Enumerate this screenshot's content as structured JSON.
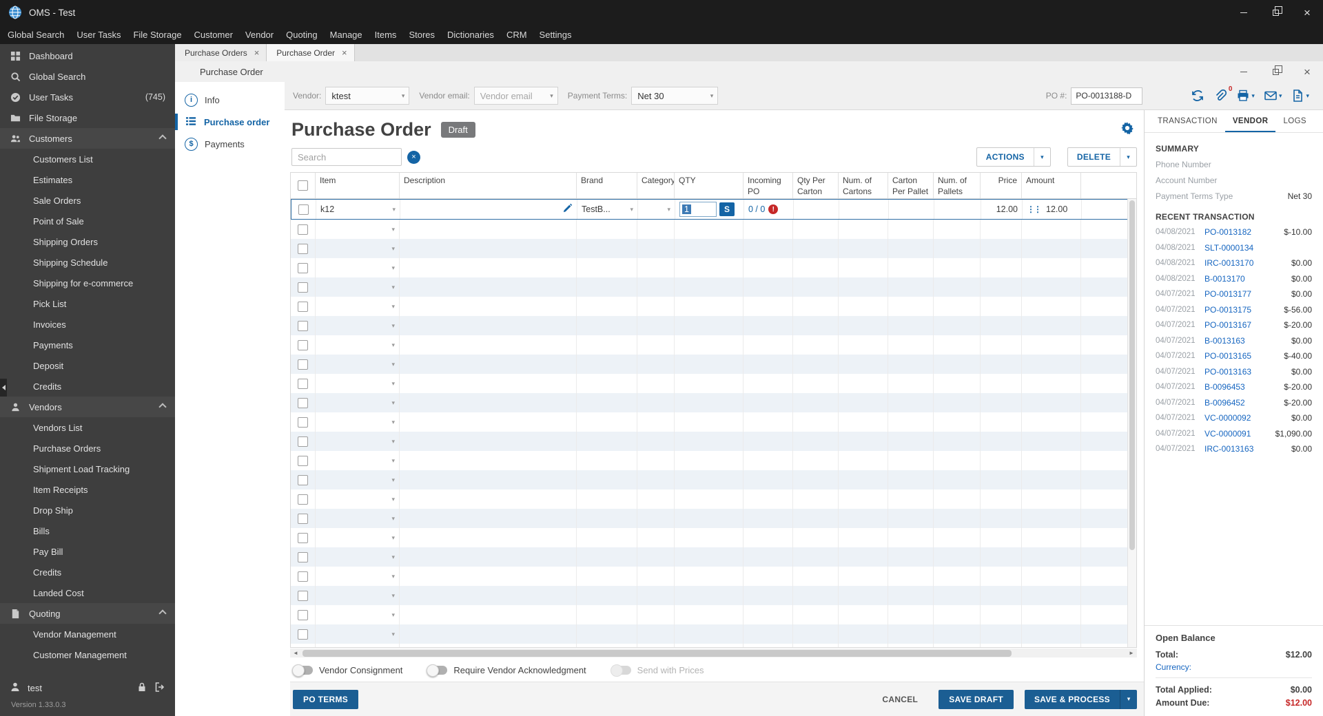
{
  "titlebar": {
    "title": "OMS - Test"
  },
  "menu": {
    "items": [
      {
        "label": "Global Search"
      },
      {
        "label": "User Tasks"
      },
      {
        "label": "File Storage"
      },
      {
        "label": "Customer"
      },
      {
        "label": "Vendor"
      },
      {
        "label": "Quoting"
      },
      {
        "label": "Manage"
      },
      {
        "label": "Items"
      },
      {
        "label": "Stores"
      },
      {
        "label": "Dictionaries"
      },
      {
        "label": "CRM"
      },
      {
        "label": "Settings"
      }
    ]
  },
  "sidebar": {
    "items": [
      {
        "label": "Dashboard",
        "icon": "dashboard",
        "type": "item"
      },
      {
        "label": "Global Search",
        "icon": "search",
        "type": "item"
      },
      {
        "label": "User Tasks",
        "icon": "tasks",
        "type": "item",
        "badge": "(745)"
      },
      {
        "label": "File Storage",
        "icon": "storage",
        "type": "item"
      },
      {
        "label": "Customers",
        "icon": "customers",
        "type": "group"
      },
      {
        "label": "Customers List",
        "type": "sub"
      },
      {
        "label": "Estimates",
        "type": "sub"
      },
      {
        "label": "Sale Orders",
        "type": "sub"
      },
      {
        "label": "Point of Sale",
        "type": "sub"
      },
      {
        "label": "Shipping Orders",
        "type": "sub"
      },
      {
        "label": "Shipping Schedule",
        "type": "sub"
      },
      {
        "label": "Shipping for e-commerce",
        "type": "sub"
      },
      {
        "label": "Pick List",
        "type": "sub"
      },
      {
        "label": "Invoices",
        "type": "sub"
      },
      {
        "label": "Payments",
        "type": "sub"
      },
      {
        "label": "Deposit",
        "type": "sub"
      },
      {
        "label": "Credits",
        "type": "sub"
      },
      {
        "label": "Vendors",
        "icon": "vendors",
        "type": "group"
      },
      {
        "label": "Vendors List",
        "type": "sub"
      },
      {
        "label": "Purchase Orders",
        "type": "sub"
      },
      {
        "label": "Shipment Load Tracking",
        "type": "sub"
      },
      {
        "label": "Item Receipts",
        "type": "sub"
      },
      {
        "label": "Drop Ship",
        "type": "sub"
      },
      {
        "label": "Bills",
        "type": "sub"
      },
      {
        "label": "Pay Bill",
        "type": "sub"
      },
      {
        "label": "Credits",
        "type": "sub"
      },
      {
        "label": "Landed Cost",
        "type": "sub"
      },
      {
        "label": "Quoting",
        "icon": "quoting",
        "type": "group"
      },
      {
        "label": "Vendor Management",
        "type": "sub"
      },
      {
        "label": "Customer Management",
        "type": "sub"
      }
    ],
    "user": "test",
    "version": "Version 1.33.0.3"
  },
  "tabs": [
    {
      "label": "Purchase Orders"
    },
    {
      "label": "Purchase Order"
    }
  ],
  "window": {
    "title": "Purchase Order"
  },
  "toolbar": {
    "vendor_label": "Vendor:",
    "vendor_value": "ktest",
    "email_label": "Vendor email:",
    "email_placeholder": "Vendor email",
    "terms_label": "Payment Terms:",
    "terms_value": "Net 30",
    "po_label": "PO #:",
    "po_value": "PO-0013188-D",
    "attachment_count": "0"
  },
  "nav": {
    "info": "Info",
    "purchase_order": "Purchase order",
    "payments": "Payments"
  },
  "po": {
    "title": "Purchase Order",
    "status": "Draft",
    "search_placeholder": "Search",
    "actions_label": "ACTIONS",
    "delete_label": "DELETE",
    "table": {
      "columns": [
        {
          "key": "item",
          "label": "Item"
        },
        {
          "key": "desc",
          "label": "Description"
        },
        {
          "key": "brand",
          "label": "Brand"
        },
        {
          "key": "category",
          "label": "Category"
        },
        {
          "key": "qty",
          "label": "QTY"
        },
        {
          "key": "incoming",
          "label": "Incoming PO"
        },
        {
          "key": "qpc",
          "label": "Qty Per Carton"
        },
        {
          "key": "cartons",
          "label": "Num. of Cartons"
        },
        {
          "key": "cpp",
          "label": "Carton Per Pallet"
        },
        {
          "key": "pallets",
          "label": "Num. of Pallets"
        },
        {
          "key": "price",
          "label": "Price"
        },
        {
          "key": "amount",
          "label": "Amount"
        }
      ],
      "row": {
        "item": "k12",
        "brand": "TestB...",
        "qty": "1",
        "s_label": "S",
        "incoming": "0 / 0",
        "error": "!",
        "price": "12.00",
        "amount": "12.00"
      },
      "empty_row_count": 23
    },
    "toggles": [
      {
        "label": "Vendor Consignment",
        "state": "off"
      },
      {
        "label": "Require Vendor Acknowledgment",
        "state": "off"
      },
      {
        "label": "Send with Prices",
        "state": "muted"
      }
    ],
    "footer": {
      "po_terms": "PO TERMS",
      "cancel": "CANCEL",
      "save_draft": "SAVE DRAFT",
      "save_process": "SAVE & PROCESS"
    }
  },
  "right_panel": {
    "tabs": [
      {
        "label": "TRANSACTION",
        "state": "normal"
      },
      {
        "label": "VENDOR",
        "state": "active"
      },
      {
        "label": "LOGS",
        "state": "normal"
      }
    ],
    "summary_title": "SUMMARY",
    "summary": [
      {
        "label": "Phone Number",
        "value": ""
      },
      {
        "label": "Account Number",
        "value": ""
      },
      {
        "label": "Payment Terms Type",
        "value": "Net 30"
      }
    ],
    "recent_title": "RECENT TRANSACTION",
    "transactions": [
      {
        "date": "04/08/2021",
        "number": "PO-0013182",
        "amount": "$-10.00"
      },
      {
        "date": "04/08/2021",
        "number": "SLT-0000134",
        "amount": ""
      },
      {
        "date": "04/08/2021",
        "number": "IRC-0013170",
        "amount": "$0.00"
      },
      {
        "date": "04/08/2021",
        "number": "B-0013170",
        "amount": "$0.00"
      },
      {
        "date": "04/07/2021",
        "number": "PO-0013177",
        "amount": "$0.00"
      },
      {
        "date": "04/07/2021",
        "number": "PO-0013175",
        "amount": "$-56.00"
      },
      {
        "date": "04/07/2021",
        "number": "PO-0013167",
        "amount": "$-20.00"
      },
      {
        "date": "04/07/2021",
        "number": "B-0013163",
        "amount": "$0.00"
      },
      {
        "date": "04/07/2021",
        "number": "PO-0013165",
        "amount": "$-40.00"
      },
      {
        "date": "04/07/2021",
        "number": "PO-0013163",
        "amount": "$0.00"
      },
      {
        "date": "04/07/2021",
        "number": "B-0096453",
        "amount": "$-20.00"
      },
      {
        "date": "04/07/2021",
        "number": "B-0096452",
        "amount": "$-20.00"
      },
      {
        "date": "04/07/2021",
        "number": "VC-0000092",
        "amount": "$0.00"
      },
      {
        "date": "04/07/2021",
        "number": "VC-0000091",
        "amount": "$1,090.00"
      },
      {
        "date": "04/07/2021",
        "number": "IRC-0013163",
        "amount": "$0.00"
      }
    ],
    "balance": {
      "title": "Open Balance",
      "total_label": "Total:",
      "total_value": "$12.00",
      "currency_label": "Currency:",
      "applied_label": "Total Applied:",
      "applied_value": "$0.00",
      "due_label": "Amount Due:",
      "due_value": "$12.00"
    }
  }
}
